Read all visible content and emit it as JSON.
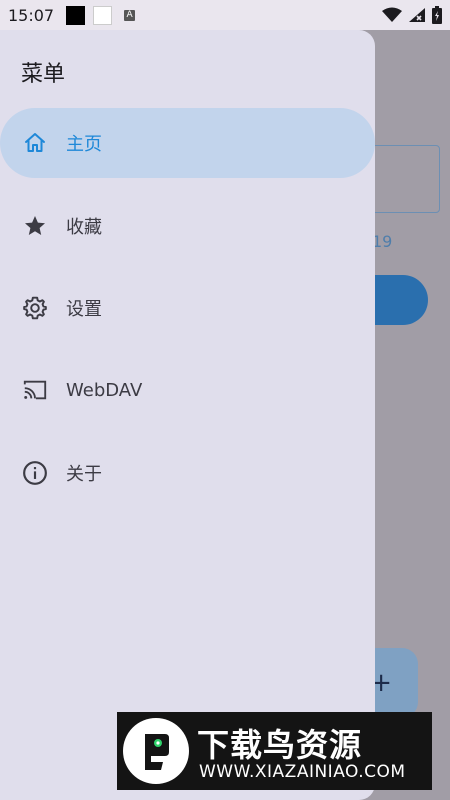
{
  "status": {
    "time": "15:07",
    "a_icon_text": "A"
  },
  "background": {
    "partial_text": "19",
    "fab_symbol": "+"
  },
  "drawer": {
    "title": "菜单",
    "items": [
      {
        "label": "主页",
        "icon": "home-icon",
        "active": true
      },
      {
        "label": "收藏",
        "icon": "star-icon",
        "active": false
      },
      {
        "label": "设置",
        "icon": "gear-icon",
        "active": false
      },
      {
        "label": "WebDAV",
        "icon": "cast-icon",
        "active": false
      },
      {
        "label": "关于",
        "icon": "info-icon",
        "active": false
      }
    ]
  },
  "watermark": {
    "title": "下载鸟资源",
    "url": "WWW.XIAZAINIAO.COM"
  },
  "colors": {
    "accent": "#1e88d8",
    "active_bg": "#c2d4ec",
    "drawer_bg": "#e0deec"
  }
}
